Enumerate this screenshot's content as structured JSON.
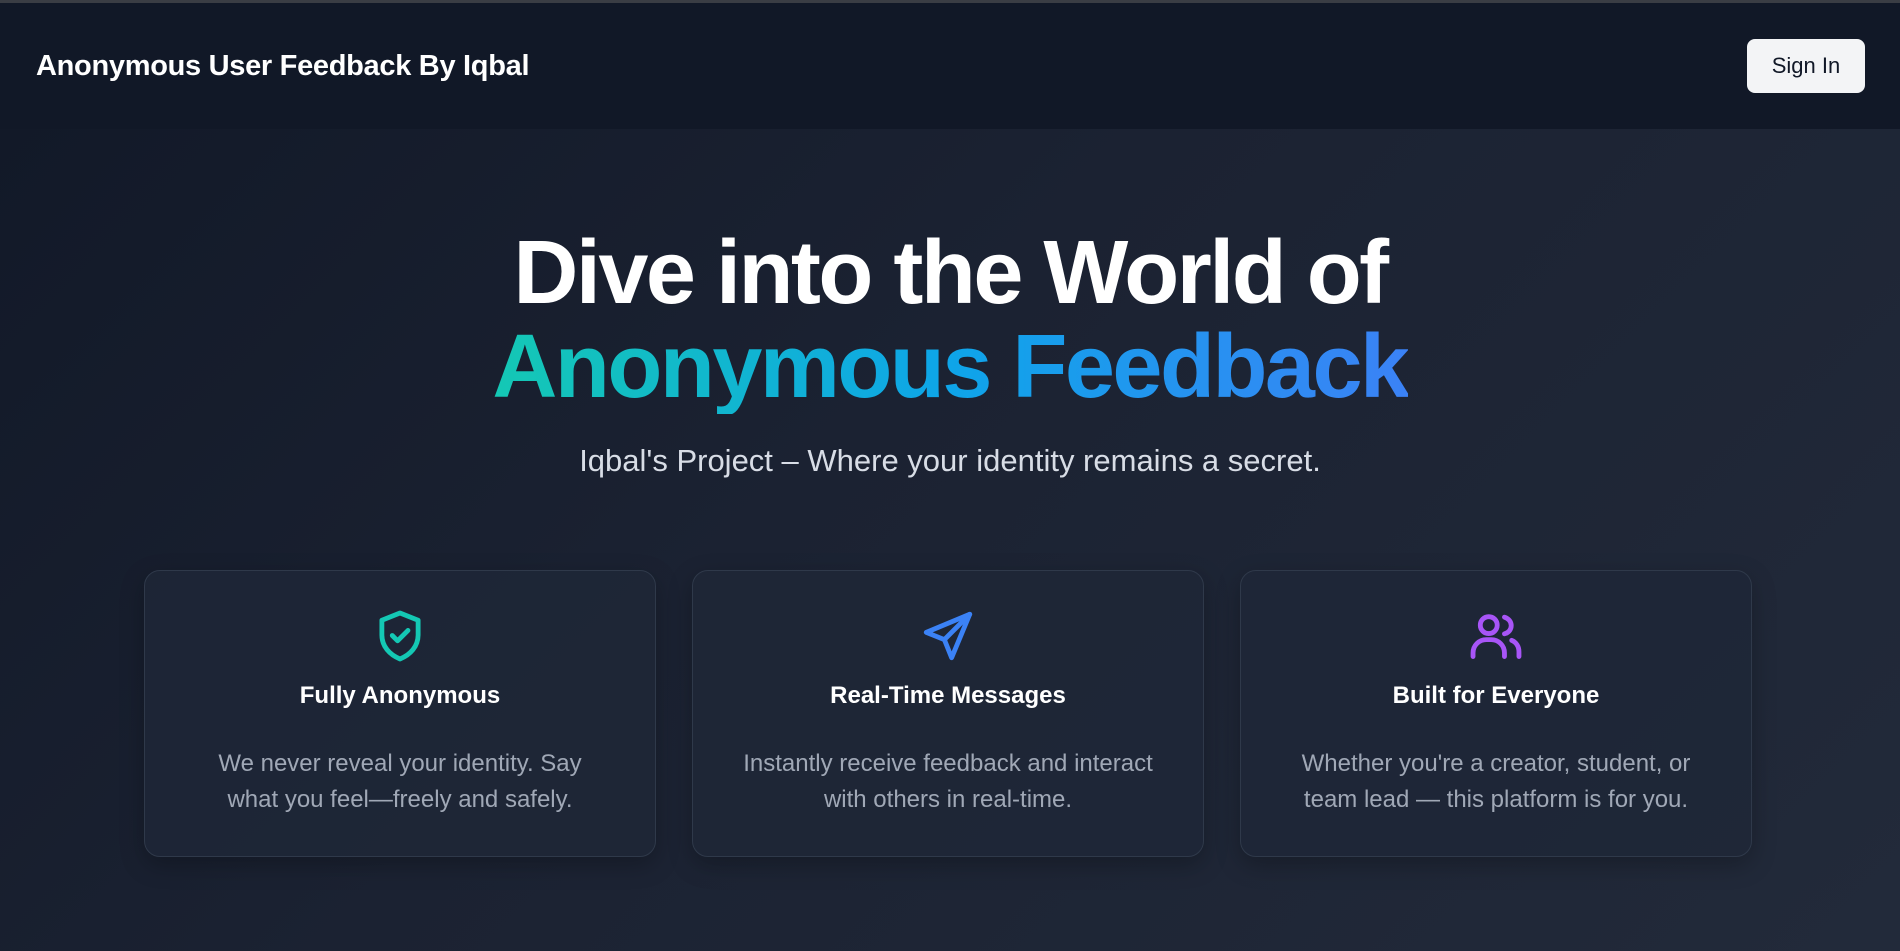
{
  "header": {
    "brand": "Anonymous User Feedback By Iqbal",
    "signin_label": "Sign In"
  },
  "hero": {
    "title_line1": "Dive into the World of",
    "title_line2": "Anonymous Feedback",
    "tagline": "Iqbal's Project – Where your identity remains a secret."
  },
  "features": [
    {
      "icon": "shield-check-icon",
      "icon_color": "#14c8b4",
      "title": "Fully Anonymous",
      "text": "We never reveal your identity. Say what you feel—freely and safely."
    },
    {
      "icon": "send-icon",
      "icon_color": "#3b82f6",
      "title": "Real-Time Messages",
      "text": "Instantly receive feedback and interact with others in real-time."
    },
    {
      "icon": "users-icon",
      "icon_color": "#a855f7",
      "title": "Built for Everyone",
      "text": "Whether you're a creator, student, or team lead — this platform is for you."
    }
  ],
  "colors": {
    "background": "#111827",
    "accent_gradient_start": "#14c8b4",
    "accent_gradient_end": "#3b82f6"
  }
}
